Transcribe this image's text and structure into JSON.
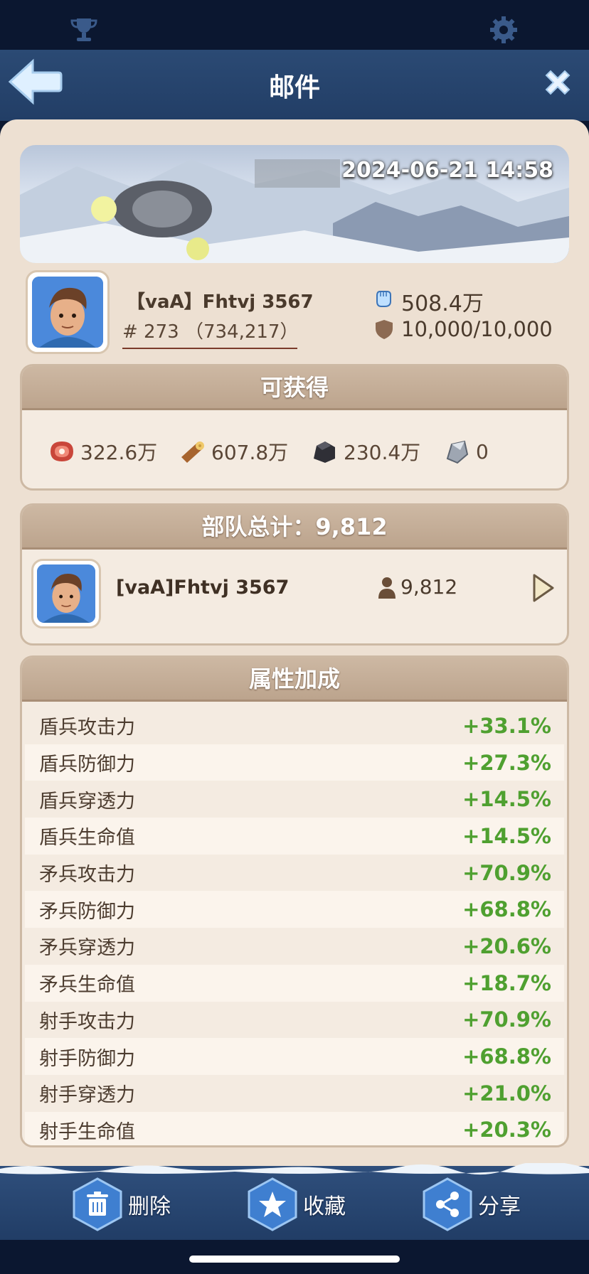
{
  "header": {
    "title": "邮件"
  },
  "mail": {
    "date": "2024-06-21 14:58",
    "player": {
      "name": "【vaA】Fhtvj 3567",
      "rank": "# 273 （734,217）",
      "power": "508.4万",
      "shield": "10,000/10,000"
    }
  },
  "rewards": {
    "title": "可获得",
    "items": [
      {
        "icon": "meat-icon",
        "value": "322.6万"
      },
      {
        "icon": "wood-icon",
        "value": "607.8万"
      },
      {
        "icon": "coal-icon",
        "value": "230.4万"
      },
      {
        "icon": "iron-icon",
        "value": "0"
      }
    ]
  },
  "troops": {
    "title": "部队总计：9,812",
    "leader": {
      "name": "[vaA]Fhtvj 3567",
      "count": "9,812"
    }
  },
  "attributes": {
    "title": "属性加成",
    "rows": [
      {
        "name": "盾兵攻击力",
        "value": "+33.1%"
      },
      {
        "name": "盾兵防御力",
        "value": "+27.3%"
      },
      {
        "name": "盾兵穿透力",
        "value": "+14.5%"
      },
      {
        "name": "盾兵生命值",
        "value": "+14.5%"
      },
      {
        "name": "矛兵攻击力",
        "value": "+70.9%"
      },
      {
        "name": "矛兵防御力",
        "value": "+68.8%"
      },
      {
        "name": "矛兵穿透力",
        "value": "+20.6%"
      },
      {
        "name": "矛兵生命值",
        "value": "+18.7%"
      },
      {
        "name": "射手攻击力",
        "value": "+70.9%"
      },
      {
        "name": "射手防御力",
        "value": "+68.8%"
      },
      {
        "name": "射手穿透力",
        "value": "+21.0%"
      },
      {
        "name": "射手生命值",
        "value": "+20.3%"
      }
    ]
  },
  "footer": {
    "delete_label": "删除",
    "favorite_label": "收藏",
    "share_label": "分享"
  },
  "colors": {
    "header_bg": "#223e66",
    "panel_bg": "#ede0d2",
    "positive": "#4fa030",
    "section_header": "#bca48d"
  }
}
